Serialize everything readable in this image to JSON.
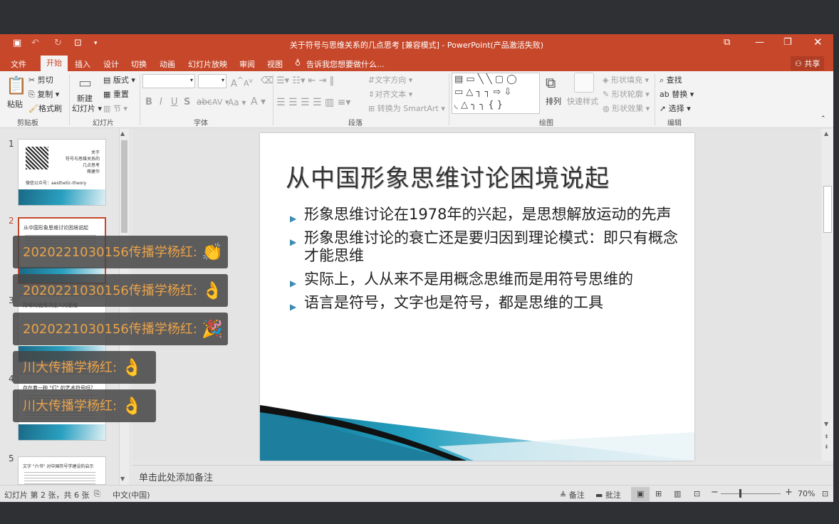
{
  "window": {
    "title": "关于符号与思维关系的几点思考 [兼容模式] - PowerPoint(产品激活失败)"
  },
  "tabs": [
    {
      "label": "文件"
    },
    {
      "label": "开始"
    },
    {
      "label": "插入"
    },
    {
      "label": "设计"
    },
    {
      "label": "切换"
    },
    {
      "label": "动画"
    },
    {
      "label": "幻灯片放映"
    },
    {
      "label": "审阅"
    },
    {
      "label": "视图"
    }
  ],
  "tell_me": "告诉我您想要做什么...",
  "share": "共享",
  "ribbon": {
    "clipboard": {
      "paste": "粘贴",
      "cut": "剪切",
      "copy": "复制",
      "format_painter": "格式刷",
      "label": "剪贴板"
    },
    "slides": {
      "new_slide": "新建",
      "new_slide2": "幻灯片",
      "layout": "版式",
      "reset": "重置",
      "section": "节",
      "label": "幻灯片"
    },
    "font": {
      "bold": "B",
      "italic": "I",
      "underline": "U",
      "strike": "S",
      "spacing": "AV",
      "case": "Aa",
      "color": "A",
      "grow": "A",
      "shrink": "A",
      "label": "字体"
    },
    "paragraph": {
      "text_direction": "文字方向",
      "align_text": "对齐文本",
      "smartart": "转换为 SmartArt",
      "label": "段落"
    },
    "drawing": {
      "arrange": "排列",
      "quick_styles": "快速样式",
      "shape_fill": "形状填充",
      "shape_outline": "形状轮廓",
      "shape_effects": "形状效果",
      "label": "绘图"
    },
    "editing": {
      "find": "查找",
      "replace": "替换",
      "select": "选择",
      "label": "编辑"
    }
  },
  "thumbnails": [
    {
      "num": "1",
      "lines": [
        "关于",
        "符号与思维关系的",
        "几点思考",
        "蒋建华",
        "微信公众号：aesthetic-theory"
      ]
    },
    {
      "num": "2",
      "lines": [
        "从中国形象思维讨论困境说起"
      ]
    },
    {
      "num": "3",
      "lines": [
        "符号的使用决定人的思维"
      ]
    },
    {
      "num": "4",
      "lines": [
        "存在着一种 \"们\" 的艺术符号吗？"
      ]
    },
    {
      "num": "5",
      "lines": [
        "文字 \"六书\" 对中国符号学建设的启示"
      ]
    }
  ],
  "slide": {
    "title": "从中国形象思维讨论困境说起",
    "bullets": [
      "形象思维讨论在1978年的兴起，是思想解放运动的先声",
      "形象思维讨论的衰亡还是要归因到理论模式：即只有概念才能思维",
      "实际上，人从来不是用概念思维而是用符号思维的",
      "语言是符号，文字也是符号，都是思维的工具"
    ]
  },
  "notes_placeholder": "单击此处添加备注",
  "status": {
    "slide_info": "幻灯片 第 2 张，共 6 张",
    "language": "中文(中国)",
    "notes": "备注",
    "comments": "批注",
    "zoom": "70%"
  },
  "danmaku": [
    {
      "text": "2020221030156传播学杨红:",
      "emoji": "👏"
    },
    {
      "text": "2020221030156传播学杨红:",
      "emoji": "👌"
    },
    {
      "text": "2020221030156传播学杨红:",
      "emoji": "🎉"
    },
    {
      "text": "川大传播学杨红:",
      "emoji": "👌"
    },
    {
      "text": "川大传播学杨红:",
      "emoji": "👌"
    }
  ],
  "colors": {
    "accent": "#c7472a",
    "bullet": "#3a8db0",
    "danmu_text": "#e9a24a"
  }
}
